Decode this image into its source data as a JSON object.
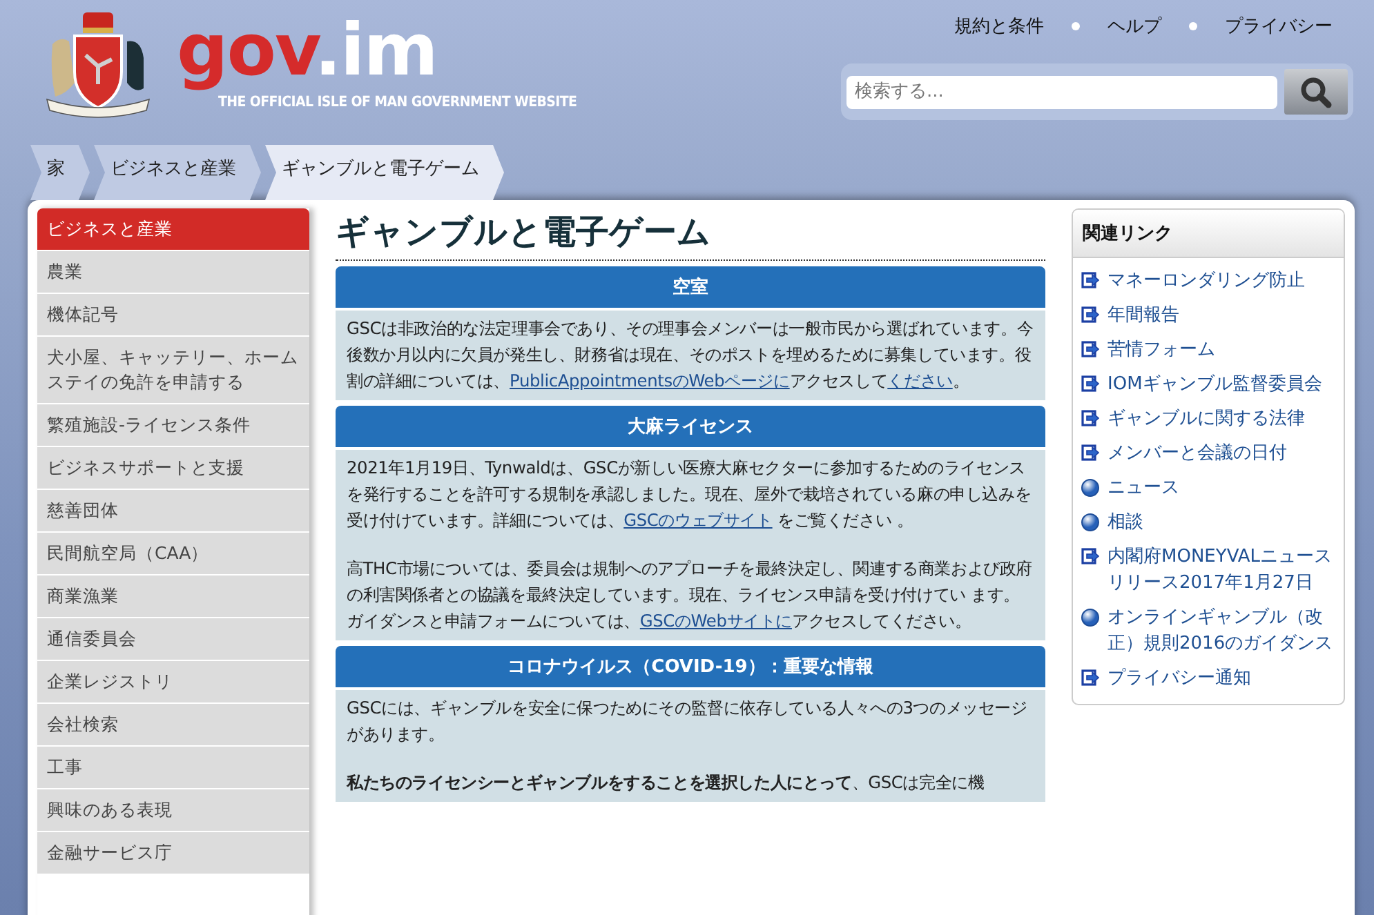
{
  "header": {
    "logo_word": "gov",
    "logo_suffix": ".im",
    "tagline": "THE OFFICIAL ISLE OF MAN GOVERNMENT WEBSITE",
    "top_links": [
      "規約と条件",
      "ヘルプ",
      "プライバシー"
    ],
    "search": {
      "placeholder": "検索する..."
    }
  },
  "breadcrumbs": [
    {
      "label": "家",
      "selected": false
    },
    {
      "label": "ビジネスと産業",
      "selected": false
    },
    {
      "label": "ギャンブルと電子ゲーム",
      "selected": true
    }
  ],
  "sidebar": {
    "items": [
      {
        "label": "ビジネスと産業",
        "selected": true
      },
      {
        "label": "農業",
        "selected": false
      },
      {
        "label": "機体記号",
        "selected": false
      },
      {
        "label": "犬小屋、キャッテリー、ホームステイの免許を申請する",
        "selected": false
      },
      {
        "label": "繁殖施設-ライセンス条件",
        "selected": false
      },
      {
        "label": "ビジネスサポートと支援",
        "selected": false
      },
      {
        "label": "慈善団体",
        "selected": false
      },
      {
        "label": "民間航空局（CAA）",
        "selected": false
      },
      {
        "label": "商業漁業",
        "selected": false
      },
      {
        "label": "通信委員会",
        "selected": false
      },
      {
        "label": "企業レジストリ",
        "selected": false
      },
      {
        "label": "会社検索",
        "selected": false
      },
      {
        "label": "工事",
        "selected": false
      },
      {
        "label": "興味のある表現",
        "selected": false
      },
      {
        "label": "金融サービス庁",
        "selected": false
      }
    ]
  },
  "article": {
    "title": "ギャンブルと電子ゲーム",
    "sections": [
      {
        "heading": "空室",
        "paragraphs": [
          [
            {
              "kind": "text",
              "text": "GSCは非政治的な法定理事会であり、その理事会メンバーは一般市民から選ばれています。今後数か月以内に欠員が発生し、財務省は現在、そのポストを埋めるために募集しています。役割の詳細については、"
            },
            {
              "kind": "link",
              "text": "PublicAppointmentsのWebページに"
            },
            {
              "kind": "text",
              "text": "アクセスして"
            },
            {
              "kind": "link",
              "text": "ください"
            },
            {
              "kind": "text",
              "text": "。"
            }
          ]
        ]
      },
      {
        "heading": "大麻ライセンス",
        "paragraphs": [
          [
            {
              "kind": "text",
              "text": "2021年1月19日、Tynwaldは、GSCが新しい医療大麻セクターに参加するためのライセンスを発行することを許可する規制を承認しました。現在、屋外で栽培されている麻の申し込みを受け付けています。詳細については、"
            },
            {
              "kind": "link",
              "text": "GSCのウェブサイト"
            },
            {
              "kind": "text",
              "text": " をご覧ください 。"
            }
          ],
          [
            {
              "kind": "text",
              "text": "高THC市場については、委員会は規制へのアプローチを最終決定し、関連する商業および政府の利害関係者との協議を最終決定しています。現在、ライセンス申請を受け付けてい ます。ガイダンスと申請フォームについては、"
            },
            {
              "kind": "link",
              "text": "GSCのWebサイトに"
            },
            {
              "kind": "text",
              "text": "アクセスしてください。"
            }
          ]
        ]
      },
      {
        "heading": "コロナウイルス（COVID-19）：重要な情報",
        "paragraphs": [
          [
            {
              "kind": "text",
              "text": "GSCには、ギャンブルを安全に保つためにその監督に依存している人々への3つのメッセージがあります。"
            }
          ],
          [
            {
              "kind": "text",
              "text": "**私たちのライセンシーとギャンブルをすることを選択した人にとって**、GSCは完全に機"
            }
          ]
        ]
      }
    ]
  },
  "related": {
    "title": "関連リンク",
    "links": [
      {
        "label": "マネーロンダリング防止",
        "kind": "page"
      },
      {
        "label": "年間報告",
        "kind": "page"
      },
      {
        "label": "苦情フォーム",
        "kind": "page"
      },
      {
        "label": "IOMギャンブル監督委員会",
        "kind": "page"
      },
      {
        "label": "ギャンブルに関する法律",
        "kind": "page"
      },
      {
        "label": "メンバーと会議の日付",
        "kind": "page"
      },
      {
        "label": "ニュース",
        "kind": "web"
      },
      {
        "label": "相談",
        "kind": "web"
      },
      {
        "label": "内閣府MONEYVALニュースリリース2017年1月27日",
        "kind": "page"
      },
      {
        "label": "オンラインギャンブル（改正）規則2016のガイダンス",
        "kind": "web"
      },
      {
        "label": "プライバシー通知",
        "kind": "page"
      }
    ]
  }
}
